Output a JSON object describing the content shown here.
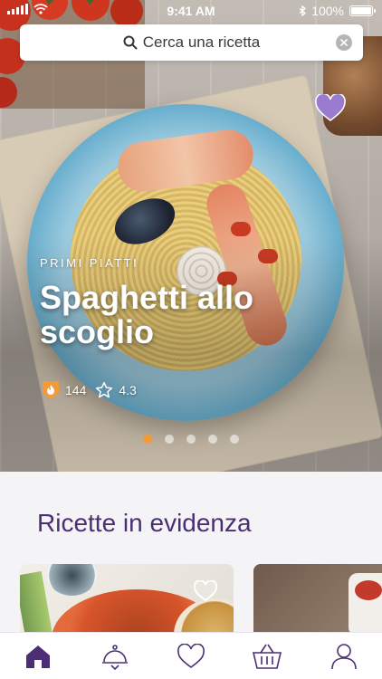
{
  "status_bar": {
    "time": "9:41 AM",
    "battery": "100%"
  },
  "search": {
    "placeholder": "Cerca una ricetta",
    "icon": "search-icon",
    "clear_icon": "close-icon"
  },
  "hero": {
    "category": "PRIMI PIATTI",
    "title": "Spaghetti allo scoglio",
    "calories": "144",
    "rating": "4.3",
    "favorite_icon": "heart-icon",
    "slides": 5,
    "active_slide": 1
  },
  "featured": {
    "title": "Ricette in evidenza"
  },
  "tabs": [
    {
      "name": "home",
      "icon": "home-icon",
      "active": true
    },
    {
      "name": "recipes",
      "icon": "cloche-icon",
      "active": false
    },
    {
      "name": "favorites",
      "icon": "heart-outline-icon",
      "active": false
    },
    {
      "name": "shopping",
      "icon": "basket-icon",
      "active": false
    },
    {
      "name": "profile",
      "icon": "user-icon",
      "active": false
    }
  ],
  "colors": {
    "accent": "#4b2e73",
    "heart": "#9a7bcf",
    "dot_active": "#f29a3a",
    "badge": "#f29a3a"
  }
}
